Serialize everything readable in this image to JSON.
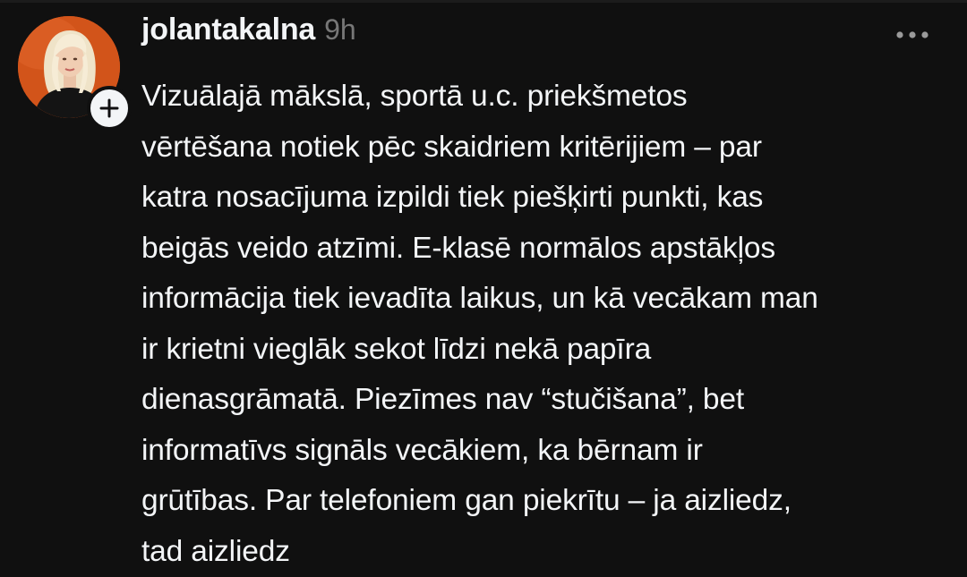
{
  "post": {
    "username": "jolantakalna",
    "timestamp": "9h",
    "body": "Vizuālajā mākslā, sportā u.c. priekšmetos\nvērtēšana notiek pēc skaidriem kritērijiem – par\nkatra nosacījuma izpildi tiek piešķirti punkti, kas\nbeigās veido atzīmi. E-klasē normālos apstākļos\ninformācija tiek ievadīta laikus, un kā vecākam man\nir krietni vieglāk sekot līdzi nekā papīra\ndienasgrāmatā. Piezīmes nav “stučišana”, bet\ninformatīvs signāls vecākiem, ka bērnam ir\ngrūtības. Par telefoniem gan piekrītu – ja aizliedz,\ntad aizliedz",
    "avatar_icon": "profile-photo",
    "follow_icon": "plus-icon",
    "more_icon": "more-horizontal-icon"
  },
  "theme": {
    "background": "#101010",
    "text": "#f3f5f7",
    "muted": "#777777",
    "avatar_bg": "#d2541a"
  }
}
